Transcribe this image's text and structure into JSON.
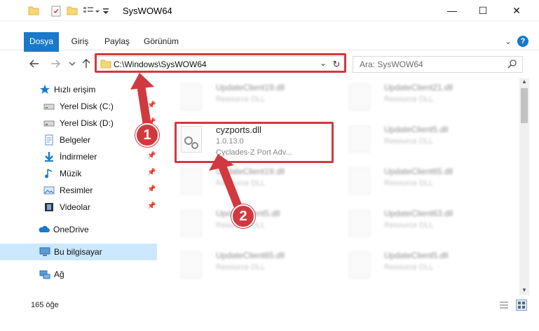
{
  "window": {
    "title": "SysWOW64",
    "minimize": "—",
    "maximize": "☐",
    "close": "✕"
  },
  "ribbon": {
    "tabs": [
      "Dosya",
      "Giriş",
      "Paylaş",
      "Görünüm"
    ],
    "help": "?"
  },
  "nav": {
    "address": "C:\\Windows\\SysWOW64",
    "search_placeholder": "Ara: SysWOW64"
  },
  "sidebar": {
    "items": [
      {
        "label": "Hızlı erişim",
        "icon": "star-icon"
      },
      {
        "label": "Yerel Disk (C:)",
        "icon": "drive-icon"
      },
      {
        "label": "Yerel Disk (D:)",
        "icon": "drive-icon"
      },
      {
        "label": "Belgeler",
        "icon": "documents-icon"
      },
      {
        "label": "İndirmeler",
        "icon": "download-icon"
      },
      {
        "label": "Müzik",
        "icon": "music-icon"
      },
      {
        "label": "Resimler",
        "icon": "pictures-icon"
      },
      {
        "label": "Videolar",
        "icon": "videos-icon"
      },
      {
        "label": "OneDrive",
        "icon": "cloud-icon"
      },
      {
        "label": "Bu bilgisayar",
        "icon": "computer-icon"
      },
      {
        "label": "Ağ",
        "icon": "network-icon"
      }
    ]
  },
  "files": [
    {
      "name": "UpdateClient19.dll",
      "desc": "Resource DLL"
    },
    {
      "name": "UpdateClient21.dll",
      "desc": "Resource DLL"
    },
    {
      "name": "cyzports.dll",
      "version": "1.0.13.0",
      "desc": "Cyclades-Z Port Adv..."
    },
    {
      "name": "UpdateClient5.dll",
      "desc": "Resource DLL"
    },
    {
      "name": "UpdateClient19.dll",
      "desc": "Resource DLL"
    },
    {
      "name": "UpdateClient65.dll",
      "desc": "Resource DLL"
    },
    {
      "name": "UpdateClient5.dll",
      "desc": "Resource DLL"
    },
    {
      "name": "UpdateClient63.dll",
      "desc": "Resource DLL"
    },
    {
      "name": "UpdateClient65.dll",
      "desc": "Resource DLL"
    },
    {
      "name": "UpdateClient5.dll",
      "desc": "Resource DLL"
    }
  ],
  "status": {
    "count": "165 öğe"
  },
  "annotations": {
    "step1": "1",
    "step2": "2",
    "color": "#d1393f"
  }
}
